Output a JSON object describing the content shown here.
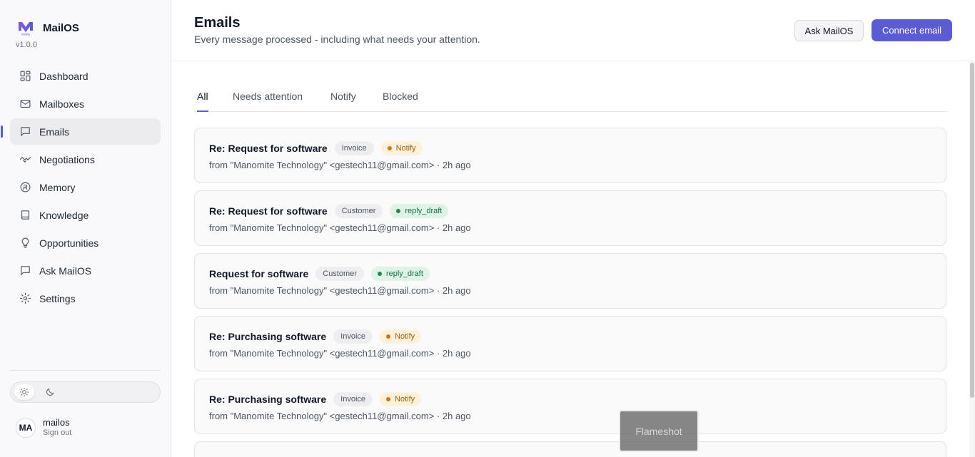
{
  "brand": {
    "name": "MailOS",
    "version": "v1.0.0",
    "logo_text": "mailos"
  },
  "sidebar": {
    "items": [
      {
        "label": "Dashboard",
        "icon": "dashboard-grid-icon"
      },
      {
        "label": "Mailboxes",
        "icon": "mail-icon"
      },
      {
        "label": "Emails",
        "icon": "message-square-icon",
        "active": true
      },
      {
        "label": "Negotiations",
        "icon": "handshake-icon"
      },
      {
        "label": "Memory",
        "icon": "brain-icon"
      },
      {
        "label": "Knowledge",
        "icon": "book-icon"
      },
      {
        "label": "Opportunities",
        "icon": "lightbulb-icon"
      },
      {
        "label": "Ask MailOS",
        "icon": "message-icon"
      },
      {
        "label": "Settings",
        "icon": "gear-icon"
      }
    ],
    "theme": {
      "selected": "light",
      "icons": [
        "sun-icon",
        "moon-icon"
      ]
    },
    "user": {
      "initials": "MA",
      "name": "mailos",
      "sign_out": "Sign out"
    }
  },
  "header": {
    "title": "Emails",
    "subtitle": "Every message processed - including what needs your attention.",
    "ask_label": "Ask MailOS",
    "connect_label": "Connect email"
  },
  "tabs": [
    {
      "label": "All",
      "active": true
    },
    {
      "label": "Needs attention"
    },
    {
      "label": "Notify"
    },
    {
      "label": "Blocked"
    }
  ],
  "emails": [
    {
      "subject": "Re: Request for software",
      "tag": "Invoice",
      "status": "Notify",
      "status_kind": "notify",
      "from": "from \"Manomite Technology\" <gestech11@gmail.com> · 2h ago"
    },
    {
      "subject": "Re: Request for software",
      "tag": "Customer",
      "status": "reply_draft",
      "status_kind": "draft",
      "from": "from \"Manomite Technology\" <gestech11@gmail.com> · 2h ago"
    },
    {
      "subject": "Request for software",
      "tag": "Customer",
      "status": "reply_draft",
      "status_kind": "draft",
      "from": "from \"Manomite Technology\" <gestech11@gmail.com> · 2h ago"
    },
    {
      "subject": "Re: Purchasing software",
      "tag": "Invoice",
      "status": "Notify",
      "status_kind": "notify",
      "from": "from \"Manomite Technology\" <gestech11@gmail.com> · 2h ago"
    },
    {
      "subject": "Re: Purchasing software",
      "tag": "Invoice",
      "status": "Notify",
      "status_kind": "notify",
      "from": "from \"Manomite Technology\" <gestech11@gmail.com> · 2h ago"
    }
  ],
  "overlay": {
    "label": "Flameshot"
  },
  "colors": {
    "accent": "#5b5bd6",
    "notify": "#c97a0a",
    "draft": "#1b8a54"
  }
}
